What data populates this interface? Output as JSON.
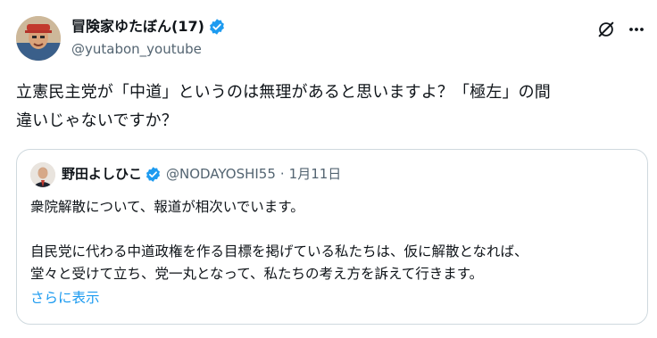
{
  "tweet": {
    "author_name": "冒険家ゆたぼん(17)",
    "author_handle": "@yutabon_youtube",
    "text_line1": "立憲民主党が「中道」というのは無理があると思いますよ？「極左」の間",
    "text_line2": "違いじゃないですか？"
  },
  "quoted_tweet": {
    "author_name": "野田よしひこ",
    "author_handle": "@NODAYOSHI55",
    "separator": "·",
    "date": "1月11日",
    "line1": "衆院解散について、報道が相次いでいます。",
    "line2": "自民党に代わる中道政権を作る目標を掲げている私たちは、仮に解散となれば、",
    "line3": "堂々と受けて立ち、党一丸となって、私たちの考え方を訴えて行きます。",
    "show_more": "さらに表示"
  },
  "icons": {
    "verified": "verified-badge-icon",
    "grok": "grok-icon",
    "more": "more-options-icon"
  },
  "colors": {
    "verified_blue": "#1d9bf0",
    "link_blue": "#1d9bf0",
    "secondary_text": "#536471",
    "border": "#cfd9de"
  }
}
